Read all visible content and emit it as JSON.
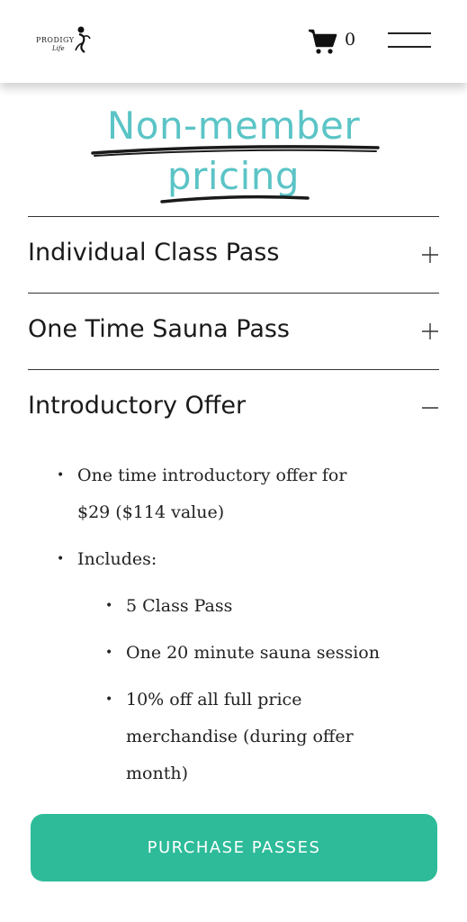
{
  "header": {
    "logo_text": "PRODIGY",
    "logo_sub": "Life",
    "cart_count": "0"
  },
  "title": {
    "line1": "Non-member",
    "line2": "pricing",
    "color": "#5bc4c6"
  },
  "accordion": [
    {
      "label": "Individual Class Pass",
      "state": "collapsed",
      "icon": "plus-icon"
    },
    {
      "label": "One Time Sauna Pass",
      "state": "collapsed",
      "icon": "plus-icon"
    },
    {
      "label": "Introductory Offer",
      "state": "expanded",
      "icon": "minus-icon"
    }
  ],
  "offer": {
    "item1_line1": "One time introductory offer for",
    "item1_line2": "$29 ($114 value)",
    "item2": "Includes:",
    "sub1": "5 Class Pass",
    "sub2": "One 20 minute sauna session",
    "sub3_line1": "10% off all full price",
    "sub3_line2": "merchandise (during offer",
    "sub3_line3": "month)",
    "bullet": "•"
  },
  "button": {
    "label": "PURCHASE PASSES",
    "color": "#2dbb99"
  }
}
